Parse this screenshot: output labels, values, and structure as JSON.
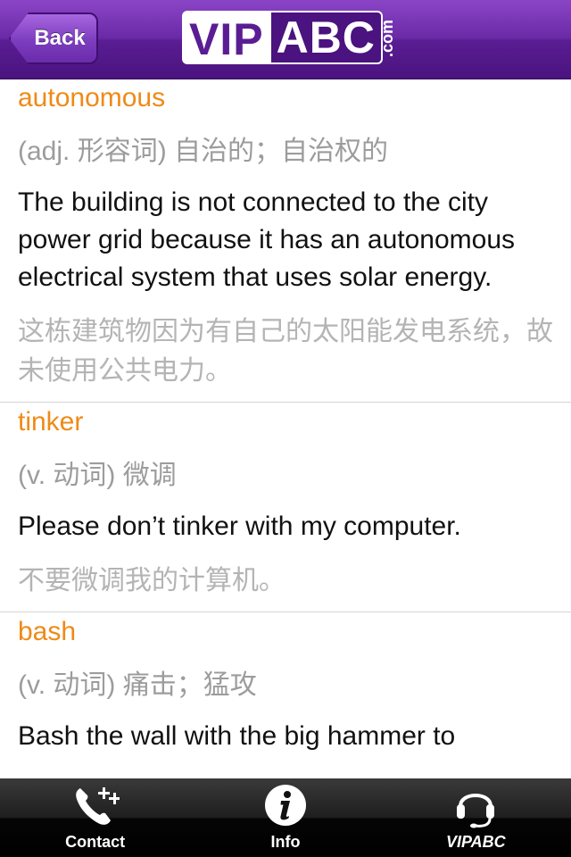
{
  "header": {
    "back_label": "Back",
    "logo_left": "VIP",
    "logo_right": "ABC",
    "logo_suffix": ".com"
  },
  "entries": [
    {
      "word": "autonomous",
      "pos": "(adj. 形容词) 自治的；自治权的",
      "example": "The building is not connected to the city power grid because it has an autonomous electrical system that uses solar energy.",
      "translation": "这栋建筑物因为有自己的太阳能发电系统，故未使用公共电力。"
    },
    {
      "word": "tinker",
      "pos": "(v. 动词) 微调",
      "example": "Please don’t tinker with my computer.",
      "translation": "不要微调我的计算机。"
    },
    {
      "word": "bash",
      "pos": "(v. 动词) 痛击；猛攻",
      "example": "Bash the wall with the big hammer to",
      "translation": ""
    }
  ],
  "tabbar": {
    "contact_label": "Contact",
    "info_label": "Info",
    "vipabc_label": "VIPABC",
    "contact_icon": "phone-plus-icon",
    "info_icon": "info-icon",
    "vipabc_icon": "headset-icon"
  },
  "colors": {
    "nav_purple": "#5a1d93",
    "word_orange": "#ef8a16",
    "pos_gray": "#9c9c9c",
    "translation_gray": "#b4b4b4"
  }
}
